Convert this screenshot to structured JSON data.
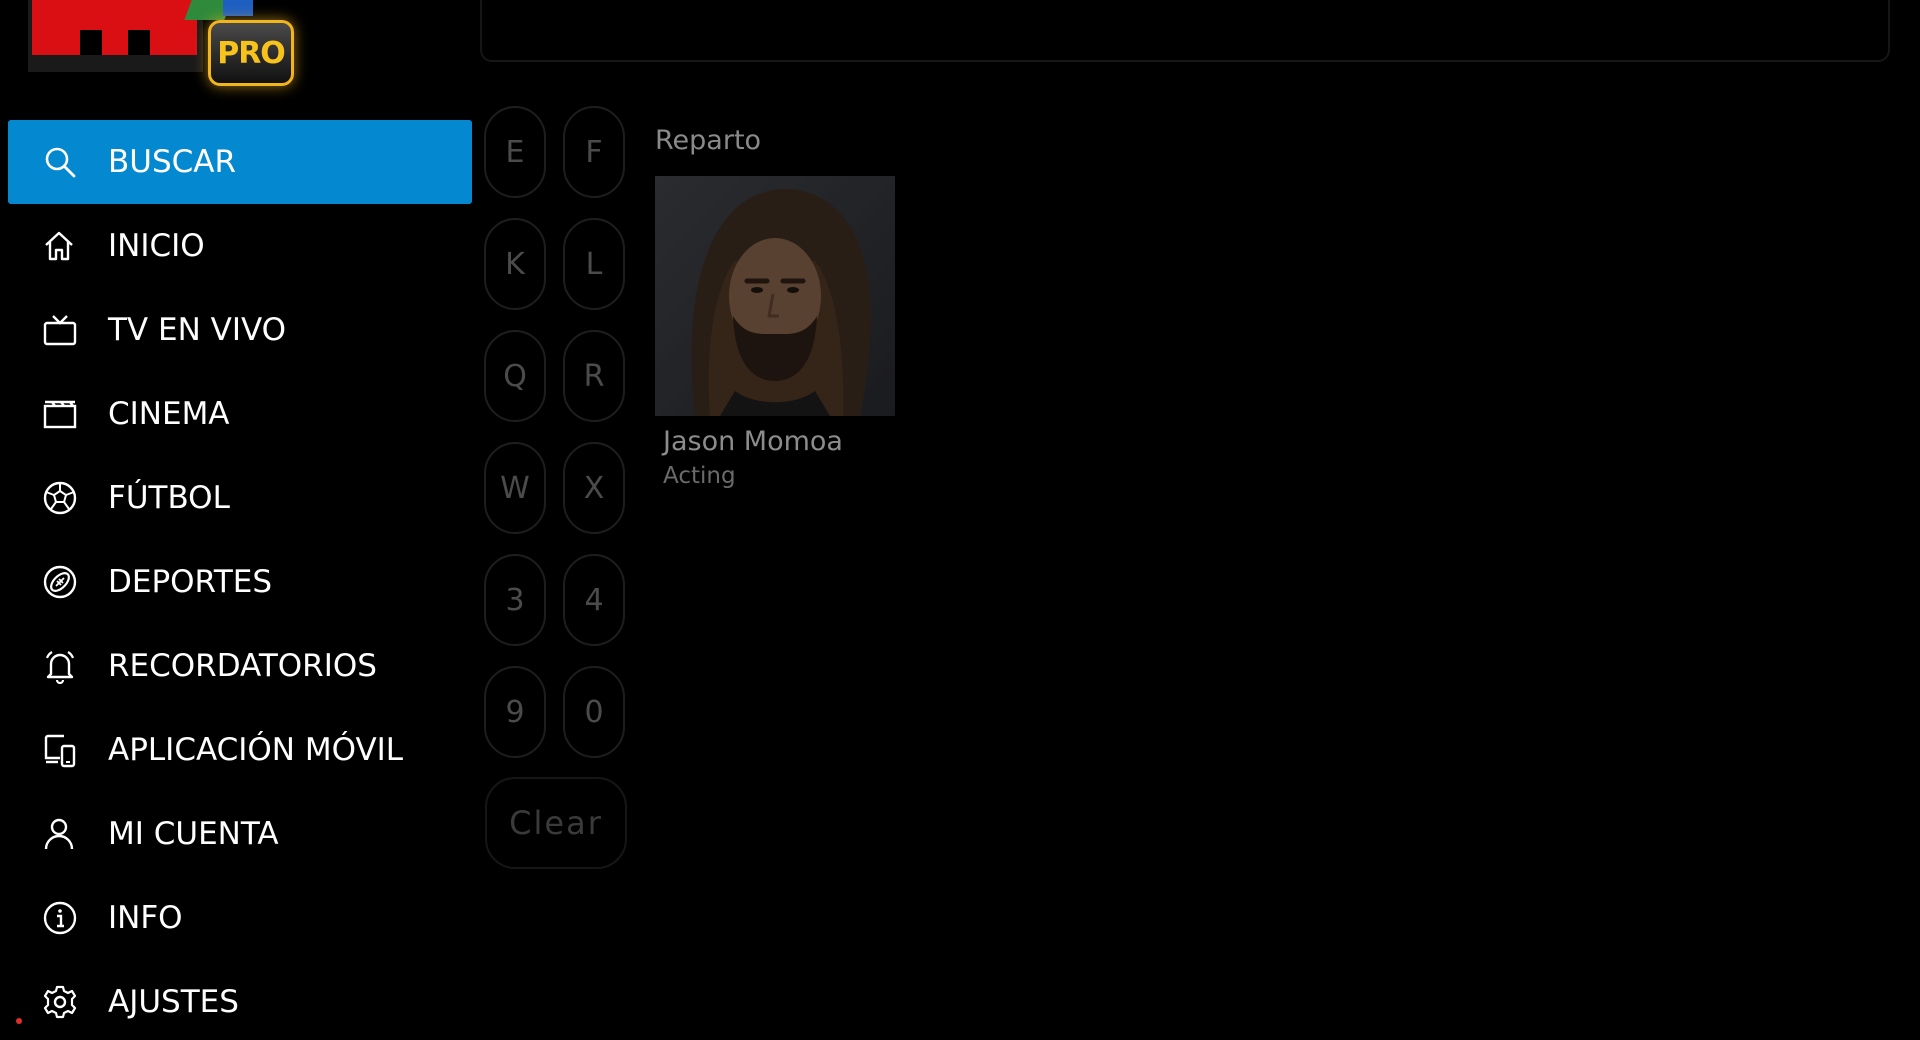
{
  "app": {
    "logo_badge": "PRO"
  },
  "sidebar": {
    "items": [
      {
        "label": "BUSCAR",
        "icon": "search-icon",
        "active": true
      },
      {
        "label": "INICIO",
        "icon": "home-icon"
      },
      {
        "label": "TV EN VIVO",
        "icon": "tv-icon"
      },
      {
        "label": "CINEMA",
        "icon": "clapperboard-icon"
      },
      {
        "label": "FÚTBOL",
        "icon": "soccer-ball-icon"
      },
      {
        "label": "DEPORTES",
        "icon": "football-icon"
      },
      {
        "label": "RECORDATORIOS",
        "icon": "bell-icon"
      },
      {
        "label": "APLICACIÓN MÓVIL",
        "icon": "mobile-app-icon"
      },
      {
        "label": "MI CUENTA",
        "icon": "user-icon"
      },
      {
        "label": "INFO",
        "icon": "info-icon"
      },
      {
        "label": "AJUSTES",
        "icon": "gear-icon"
      }
    ]
  },
  "keyboard": {
    "keys": [
      "E",
      "F",
      "K",
      "L",
      "Q",
      "R",
      "W",
      "X",
      "3",
      "4",
      "9",
      "0"
    ],
    "clear_label": "Clear"
  },
  "results": {
    "section_title": "Reparto",
    "cast": [
      {
        "name": "Jason Momoa",
        "role": "Acting"
      }
    ]
  },
  "colors": {
    "accent": "#0488d0",
    "background": "#000000",
    "logo_red": "#d90f14",
    "logo_gold": "#f7c21c"
  }
}
